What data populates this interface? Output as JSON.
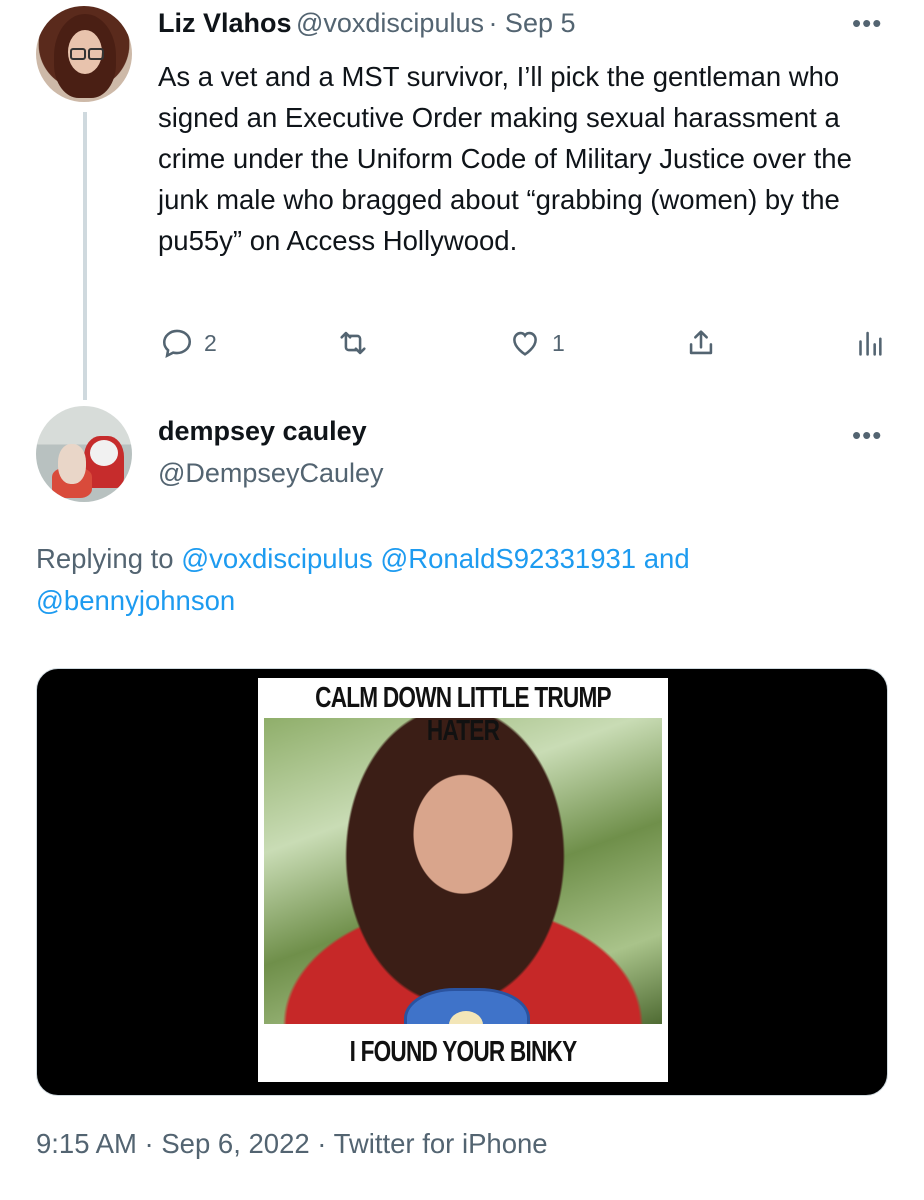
{
  "tweet1": {
    "name": "Liz Vlahos",
    "handle": "@voxdiscipulus",
    "date": "· Sep 5",
    "more": "•••",
    "text": "As a vet and a MST survivor, I’ll pick the gentleman who signed an Executive Order making sexual harassment a crime under the Uniform Code of Military Justice over the junk male who bragged about “grabbing (women) by the pu55y” on Access Hollywood.",
    "actions": {
      "reply_count": "2",
      "retweet_count": "",
      "like_count": "1"
    }
  },
  "tweet2": {
    "name": "dempsey cauley",
    "handle": "@DempseyCauley",
    "more": "•••",
    "replying_prefix": "Replying to",
    "replying_to": [
      "@voxdiscipulus",
      "@RonaldS92331931"
    ],
    "replying_and": "and",
    "replying_last": "@bennyjohnson",
    "meme_top": "CALM DOWN LITTLE TRUMP HATER",
    "meme_bottom": "I FOUND YOUR BINKY",
    "timestamp": "9:15 AM · Sep 6, 2022 · Twitter for iPhone"
  },
  "colors": {
    "link": "#1d9bf0",
    "secondary_text": "#536471",
    "primary_text": "#0f1419"
  }
}
